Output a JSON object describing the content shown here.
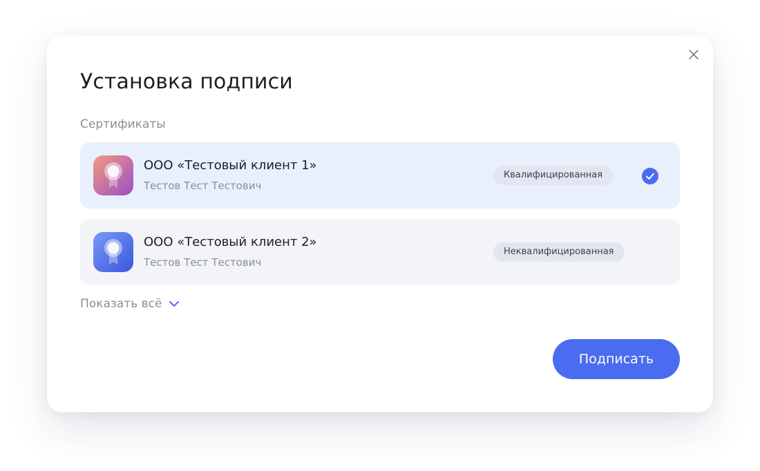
{
  "modal": {
    "title": "Установка подписи",
    "close_icon": "close-icon"
  },
  "certificates": {
    "label": "Сертификаты",
    "items": [
      {
        "organization": "ООО «Тестовый клиент 1»",
        "owner": "Тестов Тест Тестович",
        "badge": "Квалифицированная",
        "selected": true,
        "icon": "certificate-award-icon",
        "icon_colors": [
          "#e98a83",
          "#9b52c4"
        ]
      },
      {
        "organization": "ООО «Тестовый клиент 2»",
        "owner": "Тестов Тест Тестович",
        "badge": "Неквалифицированная",
        "selected": false,
        "icon": "certificate-award-icon",
        "icon_colors": [
          "#6f8ff7",
          "#3c5de0"
        ]
      }
    ],
    "show_all_label": "Показать всё",
    "show_all_icon": "chevron-down-icon"
  },
  "actions": {
    "sign_label": "Подписать"
  },
  "colors": {
    "accent": "#4a6cf0",
    "selected_background": "#e9f0fd",
    "card_background": "#f2f4f8",
    "badge_background": "#e3e6ee"
  }
}
